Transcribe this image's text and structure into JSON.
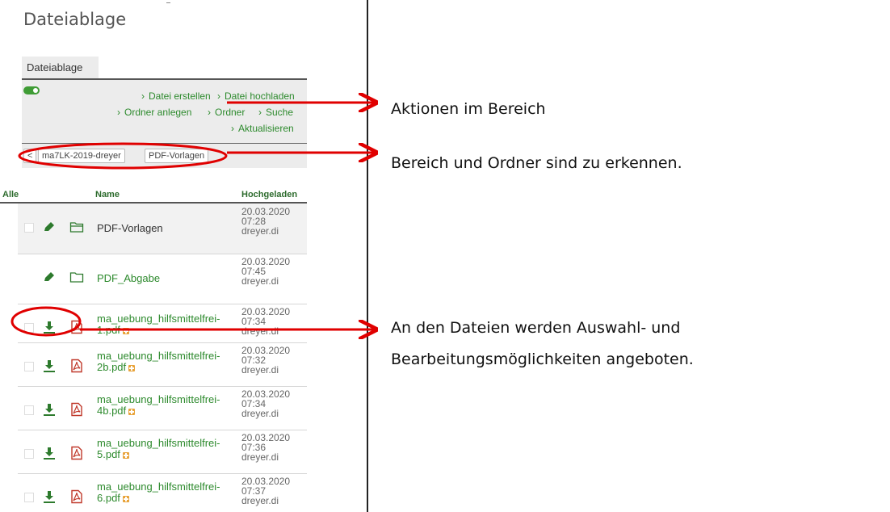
{
  "page": {
    "title": "Dateiablage"
  },
  "tabs": [
    {
      "label": "Dateiablage"
    }
  ],
  "actions": [
    {
      "label": "Datei erstellen"
    },
    {
      "label": "Datei hochladen"
    },
    {
      "label": "Ordner anlegen"
    },
    {
      "label": "Ordner"
    },
    {
      "label": "Suche"
    },
    {
      "label": "Aktualisieren"
    }
  ],
  "breadcrumb": {
    "back": "<",
    "items": [
      "ma7LK-2019-dreyer",
      "PDF-Vorlagen"
    ]
  },
  "table": {
    "columns": {
      "all": "Alle",
      "name": "Name",
      "uploaded": "Hochgeladen"
    },
    "rows": [
      {
        "type": "folder",
        "name": "PDF-Vorlagen",
        "date": "20.03.2020",
        "time": "07:28",
        "user": "dreyer.di"
      },
      {
        "type": "folder",
        "name": "PDF_Abgabe",
        "date": "20.03.2020",
        "time": "07:45",
        "user": "dreyer.di"
      },
      {
        "type": "pdf",
        "name1": "ma_uebung_hilfsmittelfrei-",
        "name2": "1.pdf",
        "date": "20.03.2020",
        "time": "07:34",
        "user": "dreyer.di"
      },
      {
        "type": "pdf",
        "name1": "ma_uebung_hilfsmittelfrei-",
        "name2": "2b.pdf",
        "date": "20.03.2020",
        "time": "07:32",
        "user": "dreyer.di"
      },
      {
        "type": "pdf",
        "name1": "ma_uebung_hilfsmittelfrei-",
        "name2": "4b.pdf",
        "date": "20.03.2020",
        "time": "07:34",
        "user": "dreyer.di"
      },
      {
        "type": "pdf",
        "name1": "ma_uebung_hilfsmittelfrei-",
        "name2": "5.pdf",
        "date": "20.03.2020",
        "time": "07:36",
        "user": "dreyer.di"
      },
      {
        "type": "pdf",
        "name1": "ma_uebung_hilfsmittelfrei-",
        "name2": "6.pdf",
        "date": "20.03.2020",
        "time": "07:37",
        "user": "dreyer.di"
      }
    ]
  },
  "annotations": {
    "actions": "Aktionen im Bereich",
    "breadcrumb": "Bereich und Ordner sind zu erkennen.",
    "files_line1": "An den Dateien werden Auswahl- und",
    "files_line2": "Bearbeitungsmöglichkeiten angeboten."
  },
  "colors": {
    "accent_green": "#2d8a2d",
    "annotation_red": "#e00000",
    "pdf_red": "#c0392b",
    "panel_gray": "#ececec"
  },
  "icons": {
    "toggle": "toggle-on-icon",
    "edit": "pencil-icon",
    "folder": "folder-icon",
    "download": "download-icon",
    "pdf": "pdf-file-icon",
    "badge": "plus-badge-icon",
    "chevron": "chevron-right-icon"
  }
}
